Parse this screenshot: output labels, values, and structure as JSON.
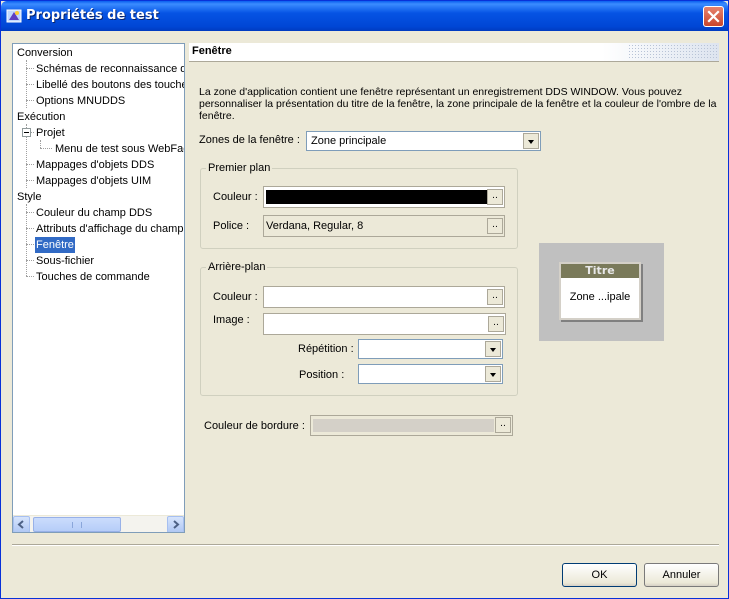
{
  "window": {
    "title": "Propriétés de test"
  },
  "tree": {
    "items": [
      {
        "label": "Conversion",
        "level": 0
      },
      {
        "label": "Schémas de reconnaissance d",
        "level": 1
      },
      {
        "label": "Libellé des boutons des touche",
        "level": 1
      },
      {
        "label": "Options MNUDDS",
        "level": 1
      },
      {
        "label": "Exécution",
        "level": 0
      },
      {
        "label": "Projet",
        "level": 1
      },
      {
        "label": "Menu de test sous WebFac",
        "level": 2
      },
      {
        "label": "Mappages d'objets DDS",
        "level": 1
      },
      {
        "label": "Mappages d'objets UIM",
        "level": 1
      },
      {
        "label": "Style",
        "level": 0
      },
      {
        "label": "Couleur du champ DDS",
        "level": 1
      },
      {
        "label": "Attributs d'affichage du champ",
        "level": 1
      },
      {
        "label": "Fenêtre",
        "level": 1,
        "selected": true
      },
      {
        "label": "Sous-fichier",
        "level": 1
      },
      {
        "label": "Touches de commande",
        "level": 1
      }
    ]
  },
  "panel": {
    "title": "Fenêtre",
    "description": "La zone d'application contient une fenêtre représentant un enregistrement DDS WINDOW.  Vous pouvez personnaliser la présentation du titre de la fenêtre, la zone principale de la fenêtre et la couleur de l'ombre de la fenêtre.",
    "zones_label": "Zones de la fenêtre :",
    "zones_value": "Zone principale",
    "foreground": {
      "title": "Premier plan",
      "color_label": "Couleur :",
      "color_value": "#000000",
      "font_label": "Police :",
      "font_value": "Verdana, Regular, 8"
    },
    "background": {
      "title": "Arrière-plan",
      "color_label": "Couleur :",
      "image_label": "Image :",
      "repeat_label": "Répétition :",
      "position_label": "Position :"
    },
    "border_label": "Couleur de bordure :",
    "ellipsis": "..",
    "preview": {
      "title": "Titre",
      "body": "Zone ...ipale"
    }
  },
  "buttons": {
    "ok": "OK",
    "cancel": "Annuler"
  }
}
